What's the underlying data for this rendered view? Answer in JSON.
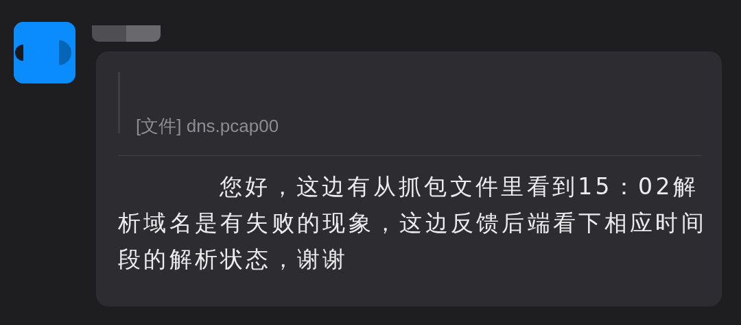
{
  "message": {
    "quote": {
      "text": "[文件] dns.pcap00"
    },
    "text": "您好，这边有从抓包文件里看到15：02解析域名是有失败的现象，这边反馈后端看下相应时间段的解析状态，谢谢"
  }
}
